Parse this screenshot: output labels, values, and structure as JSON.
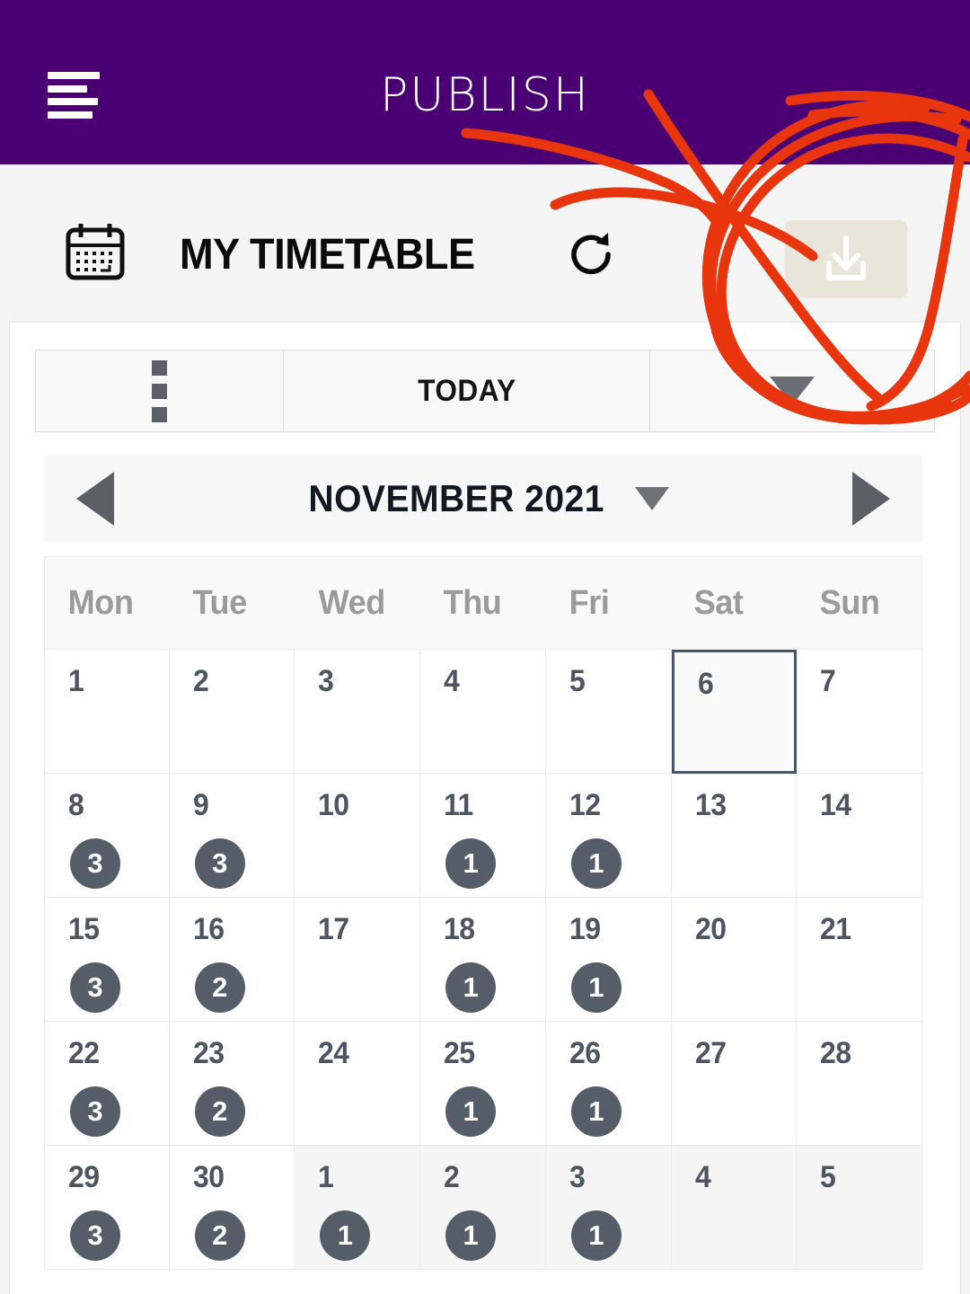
{
  "appbar": {
    "title": "PUBLISH",
    "menu_icon": "hamburger-menu-icon",
    "background_color": "#4A0072",
    "title_color": "#FFFFFF"
  },
  "subheader": {
    "calendar_icon": "calendar-icon",
    "page_title": "MY TIMETABLE",
    "refresh_icon": "refresh-icon",
    "download_icon": "download-icon",
    "download_button_color": "#E9E5DA"
  },
  "toolbar": {
    "overflow_icon": "kebab-menu-icon",
    "today_label": "TODAY",
    "dropdown_icon": "triangle-down-icon"
  },
  "month_nav": {
    "prev_icon": "triangle-left-icon",
    "next_icon": "triangle-right-icon",
    "month_label": "NOVEMBER 2021",
    "caret_icon": "triangle-down-icon"
  },
  "calendar": {
    "day_headers": [
      "Mon",
      "Tue",
      "Wed",
      "Thu",
      "Fri",
      "Sat",
      "Sun"
    ],
    "weeks": [
      [
        {
          "day": "1",
          "badge": null,
          "other_month": false,
          "selected": false
        },
        {
          "day": "2",
          "badge": null,
          "other_month": false,
          "selected": false
        },
        {
          "day": "3",
          "badge": null,
          "other_month": false,
          "selected": false
        },
        {
          "day": "4",
          "badge": null,
          "other_month": false,
          "selected": false
        },
        {
          "day": "5",
          "badge": null,
          "other_month": false,
          "selected": false
        },
        {
          "day": "6",
          "badge": null,
          "other_month": false,
          "selected": true
        },
        {
          "day": "7",
          "badge": null,
          "other_month": false,
          "selected": false
        }
      ],
      [
        {
          "day": "8",
          "badge": "3",
          "other_month": false,
          "selected": false
        },
        {
          "day": "9",
          "badge": "3",
          "other_month": false,
          "selected": false
        },
        {
          "day": "10",
          "badge": null,
          "other_month": false,
          "selected": false
        },
        {
          "day": "11",
          "badge": "1",
          "other_month": false,
          "selected": false
        },
        {
          "day": "12",
          "badge": "1",
          "other_month": false,
          "selected": false
        },
        {
          "day": "13",
          "badge": null,
          "other_month": false,
          "selected": false
        },
        {
          "day": "14",
          "badge": null,
          "other_month": false,
          "selected": false
        }
      ],
      [
        {
          "day": "15",
          "badge": "3",
          "other_month": false,
          "selected": false
        },
        {
          "day": "16",
          "badge": "2",
          "other_month": false,
          "selected": false
        },
        {
          "day": "17",
          "badge": null,
          "other_month": false,
          "selected": false
        },
        {
          "day": "18",
          "badge": "1",
          "other_month": false,
          "selected": false
        },
        {
          "day": "19",
          "badge": "1",
          "other_month": false,
          "selected": false
        },
        {
          "day": "20",
          "badge": null,
          "other_month": false,
          "selected": false
        },
        {
          "day": "21",
          "badge": null,
          "other_month": false,
          "selected": false
        }
      ],
      [
        {
          "day": "22",
          "badge": "3",
          "other_month": false,
          "selected": false
        },
        {
          "day": "23",
          "badge": "2",
          "other_month": false,
          "selected": false
        },
        {
          "day": "24",
          "badge": null,
          "other_month": false,
          "selected": false
        },
        {
          "day": "25",
          "badge": "1",
          "other_month": false,
          "selected": false
        },
        {
          "day": "26",
          "badge": "1",
          "other_month": false,
          "selected": false
        },
        {
          "day": "27",
          "badge": null,
          "other_month": false,
          "selected": false
        },
        {
          "day": "28",
          "badge": null,
          "other_month": false,
          "selected": false
        }
      ],
      [
        {
          "day": "29",
          "badge": "3",
          "other_month": false,
          "selected": false
        },
        {
          "day": "30",
          "badge": "2",
          "other_month": false,
          "selected": false
        },
        {
          "day": "1",
          "badge": "1",
          "other_month": true,
          "selected": false
        },
        {
          "day": "2",
          "badge": "1",
          "other_month": true,
          "selected": false
        },
        {
          "day": "3",
          "badge": "1",
          "other_month": true,
          "selected": false
        },
        {
          "day": "4",
          "badge": null,
          "other_month": true,
          "selected": false
        },
        {
          "day": "5",
          "badge": null,
          "other_month": true,
          "selected": false
        }
      ]
    ],
    "selected_border_color": "#46566D",
    "badge_color": "#555D69"
  },
  "annotation": {
    "description": "hand-drawn red circle scribble around download button",
    "color": "#E8350D"
  }
}
